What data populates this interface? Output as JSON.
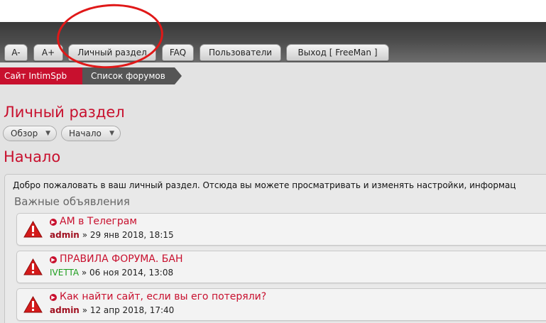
{
  "nav": {
    "font_decrease": "A-",
    "font_increase": "A+",
    "personal_section": "Личный раздел",
    "faq": "FAQ",
    "users": "Пользователи",
    "logout": "Выход [ FreeMan ]"
  },
  "breadcrumb": {
    "site": "Сайт IntimSpb",
    "forum_list": "Список форумов"
  },
  "page": {
    "title": "Личный раздел",
    "dropdown_overview": "Обзор",
    "dropdown_start": "Начало",
    "section_title": "Начало",
    "welcome_text": "Добро пожаловать в ваш личный раздел. Отсюда вы можете просматривать и изменять настройки, информац",
    "announcements_title": "Важные объявления"
  },
  "topics": [
    {
      "title": "АМ в Телеграм",
      "author": "admin",
      "date": "» 29 янв 2018, 18:15"
    },
    {
      "title": "ПРАВИЛА ФОРУМА. БАН",
      "author": "IVETTA",
      "date": "» 06 ноя 2014, 13:08"
    },
    {
      "title": "Как найти сайт, если вы его потеряли?",
      "author": "admin",
      "date": "» 12 апр 2018, 17:40"
    }
  ],
  "colors": {
    "accent": "#c8102e",
    "annotation_circle": "#e01818",
    "moderator_green": "#1e9e1e"
  },
  "icons": {
    "warning": "warning-icon",
    "bullet": "topic-bullet-icon",
    "chevron": "chevron-down-icon"
  }
}
